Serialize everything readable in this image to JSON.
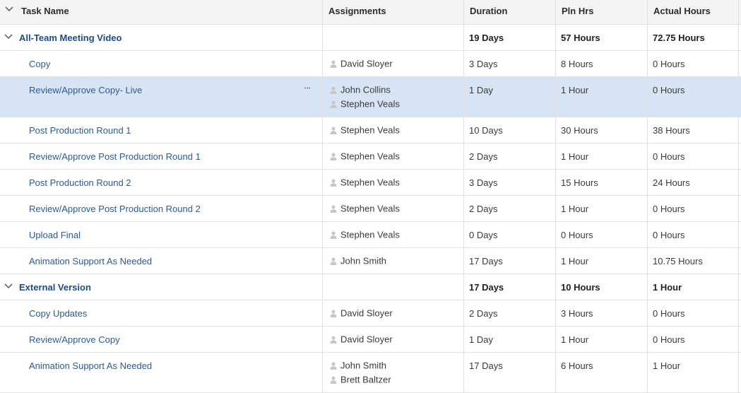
{
  "columns": {
    "task_name": "Task Name",
    "assignments": "Assignments",
    "duration": "Duration",
    "pln_hrs": "Pln Hrs",
    "actual_hours": "Actual Hours"
  },
  "groups": [
    {
      "name": "All-Team Meeting Video",
      "duration": "19 Days",
      "pln_hrs": "57 Hours",
      "actual_hours": "72.75 Hours",
      "tasks": [
        {
          "name": "Copy",
          "assignees": [
            "David Sloyer"
          ],
          "duration": "3 Days",
          "pln_hrs": "8 Hours",
          "actual_hours": "0 Hours"
        },
        {
          "name": "Review/Approve Copy- Live",
          "assignees": [
            "John Collins",
            "Stephen Veals"
          ],
          "duration": "1 Day",
          "pln_hrs": "1 Hour",
          "actual_hours": "0 Hours",
          "selected": true
        },
        {
          "name": "Post Production Round 1",
          "assignees": [
            "Stephen Veals"
          ],
          "duration": "10 Days",
          "pln_hrs": "30 Hours",
          "actual_hours": "38 Hours"
        },
        {
          "name": "Review/Approve Post Production Round 1",
          "assignees": [
            "Stephen Veals"
          ],
          "duration": "2 Days",
          "pln_hrs": "1 Hour",
          "actual_hours": "0 Hours"
        },
        {
          "name": "Post Production Round 2",
          "assignees": [
            "Stephen Veals"
          ],
          "duration": "3 Days",
          "pln_hrs": "15 Hours",
          "actual_hours": "24 Hours"
        },
        {
          "name": "Review/Approve Post Production Round 2",
          "assignees": [
            "Stephen Veals"
          ],
          "duration": "2 Days",
          "pln_hrs": "1 Hour",
          "actual_hours": "0 Hours"
        },
        {
          "name": "Upload Final",
          "assignees": [
            "Stephen Veals"
          ],
          "duration": "0 Days",
          "pln_hrs": "0 Hours",
          "actual_hours": "0 Hours"
        },
        {
          "name": "Animation Support As Needed",
          "assignees": [
            "John Smith"
          ],
          "duration": "17 Days",
          "pln_hrs": "1 Hour",
          "actual_hours": "10.75 Hours"
        }
      ]
    },
    {
      "name": "External Version",
      "duration": "17 Days",
      "pln_hrs": "10 Hours",
      "actual_hours": "1 Hour",
      "tasks": [
        {
          "name": "Copy Updates",
          "assignees": [
            "David Sloyer"
          ],
          "duration": "2 Days",
          "pln_hrs": "3 Hours",
          "actual_hours": "0 Hours"
        },
        {
          "name": "Review/Approve Copy",
          "assignees": [
            "David Sloyer"
          ],
          "duration": "1 Day",
          "pln_hrs": "1 Hour",
          "actual_hours": "0 Hours"
        },
        {
          "name": "Animation Support As Needed",
          "assignees": [
            "John Smith",
            "Brett Baltzer"
          ],
          "duration": "17 Days",
          "pln_hrs": "6 Hours",
          "actual_hours": "1 Hour"
        }
      ]
    }
  ],
  "icons": {
    "collapse": "chevron-down-icon",
    "assignee": "person-icon",
    "more": "more-options-icon"
  },
  "colors": {
    "task_link": "#2a5b9c",
    "group_link": "#1d4b88",
    "selected_row": "#d6e4f5",
    "header_bg": "#f4f4f4"
  }
}
